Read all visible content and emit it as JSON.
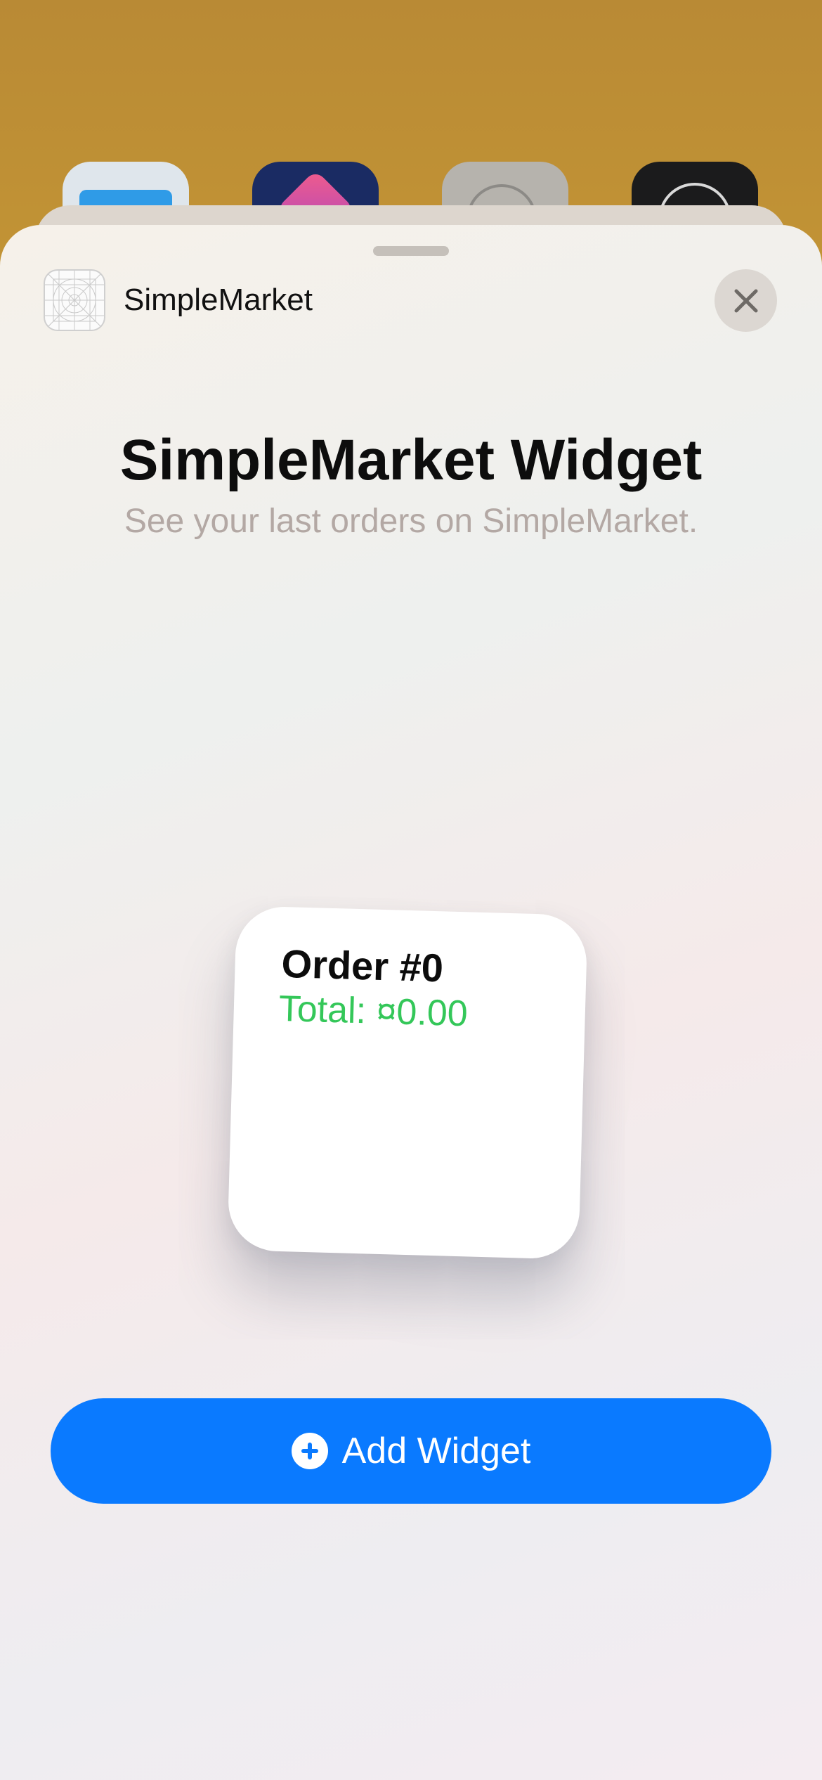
{
  "home_screen": {
    "icons": [
      "folder-icon",
      "shortcuts-icon",
      "settings-icon",
      "watch-icon"
    ]
  },
  "header": {
    "app_name": "SimpleMarket",
    "app_icon": "app-placeholder-icon",
    "close_icon": "close-icon"
  },
  "main": {
    "title": "SimpleMarket Widget",
    "subtitle": "See your last orders on SimpleMarket."
  },
  "widget": {
    "order_title": "Order #0",
    "order_total": "Total: ¤0.00",
    "total_color": "#34c759"
  },
  "footer": {
    "add_label": "Add Widget",
    "add_icon": "plus-circle-icon",
    "button_color": "#0a7aff"
  }
}
